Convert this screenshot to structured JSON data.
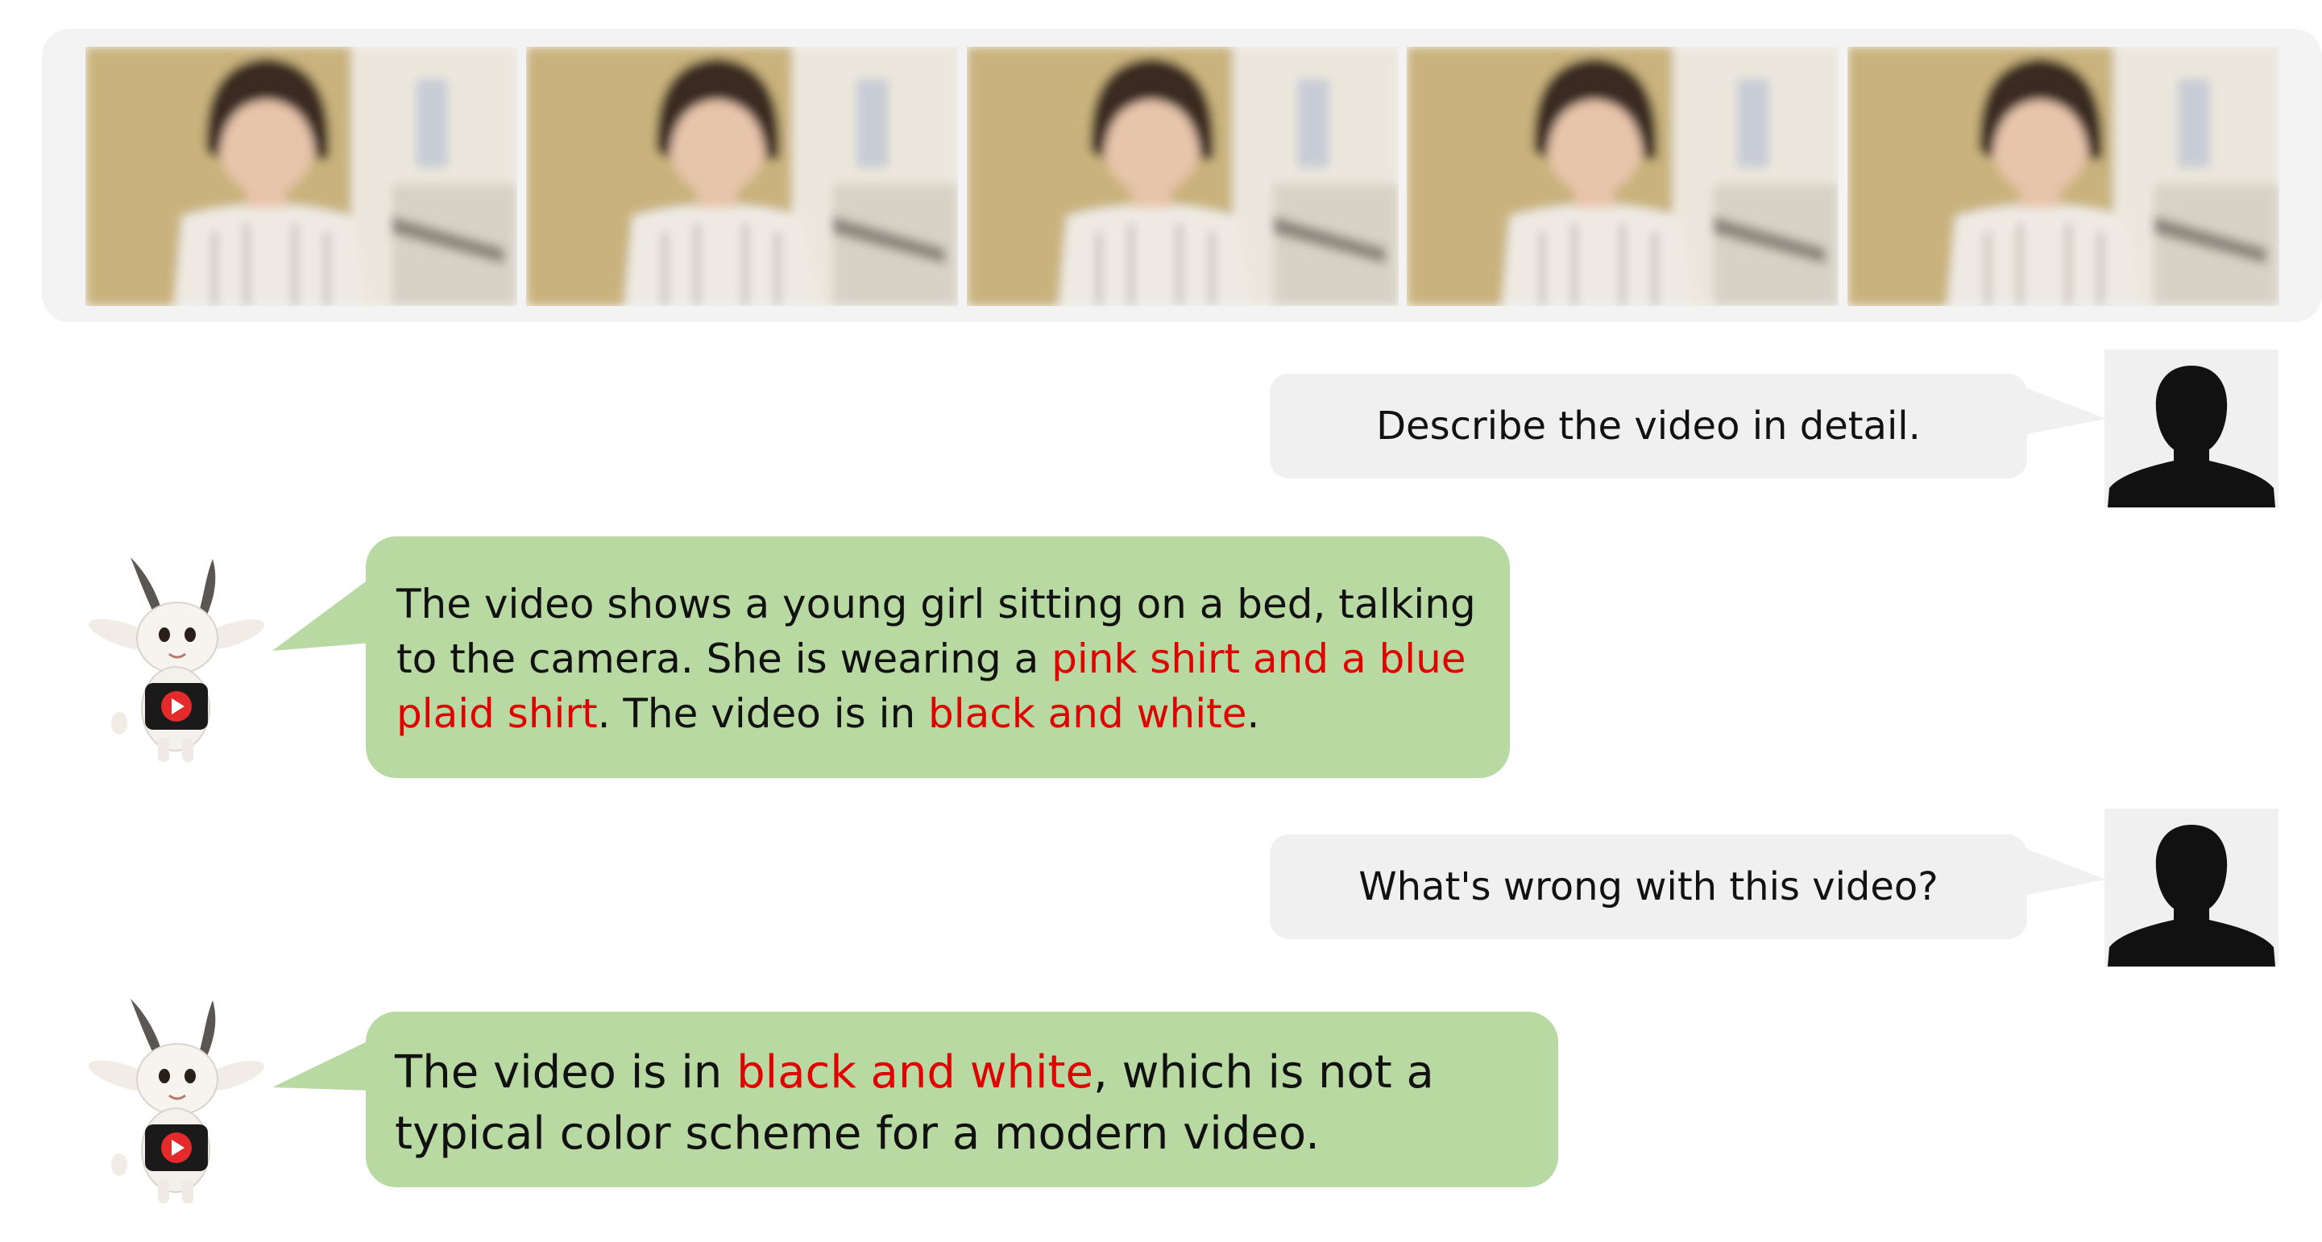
{
  "video_frames": {
    "count": 5,
    "icon": "video-frame-image",
    "colors": {
      "wall": "#c9b27d",
      "bed": "#ece7dd",
      "hair": "#3a2a20",
      "skin": "#e7c4aa",
      "shirt": "#eeeae3",
      "stripe": "#b9b3aa"
    }
  },
  "conversation": [
    {
      "role": "user",
      "text": "Describe the video in detail.",
      "avatar": "person-silhouette-icon"
    },
    {
      "role": "assistant",
      "avatar": "goat-mascot-icon",
      "segments": [
        {
          "text": "The video shows a young girl sitting on a bed, talking to the camera. She is wearing a ",
          "highlight": false
        },
        {
          "text": "pink shirt and a blue plaid shirt",
          "highlight": true
        },
        {
          "text": ". The video is in ",
          "highlight": false
        },
        {
          "text": "black and white",
          "highlight": true
        },
        {
          "text": ".",
          "highlight": false
        }
      ]
    },
    {
      "role": "user",
      "text": "What's wrong with this video?",
      "avatar": "person-silhouette-icon"
    },
    {
      "role": "assistant",
      "avatar": "goat-mascot-icon",
      "segments": [
        {
          "text": "The video is in ",
          "highlight": false
        },
        {
          "text": "black and white",
          "highlight": true
        },
        {
          "text": ", which is not a typical color scheme for a modern video.",
          "highlight": false
        }
      ]
    }
  ],
  "colors": {
    "user_bubble": "#f0f0f0",
    "assistant_bubble": "#b8d9a2",
    "highlight": "#e10000",
    "strip_background": "#f3f3f3",
    "silhouette": "#111111"
  }
}
